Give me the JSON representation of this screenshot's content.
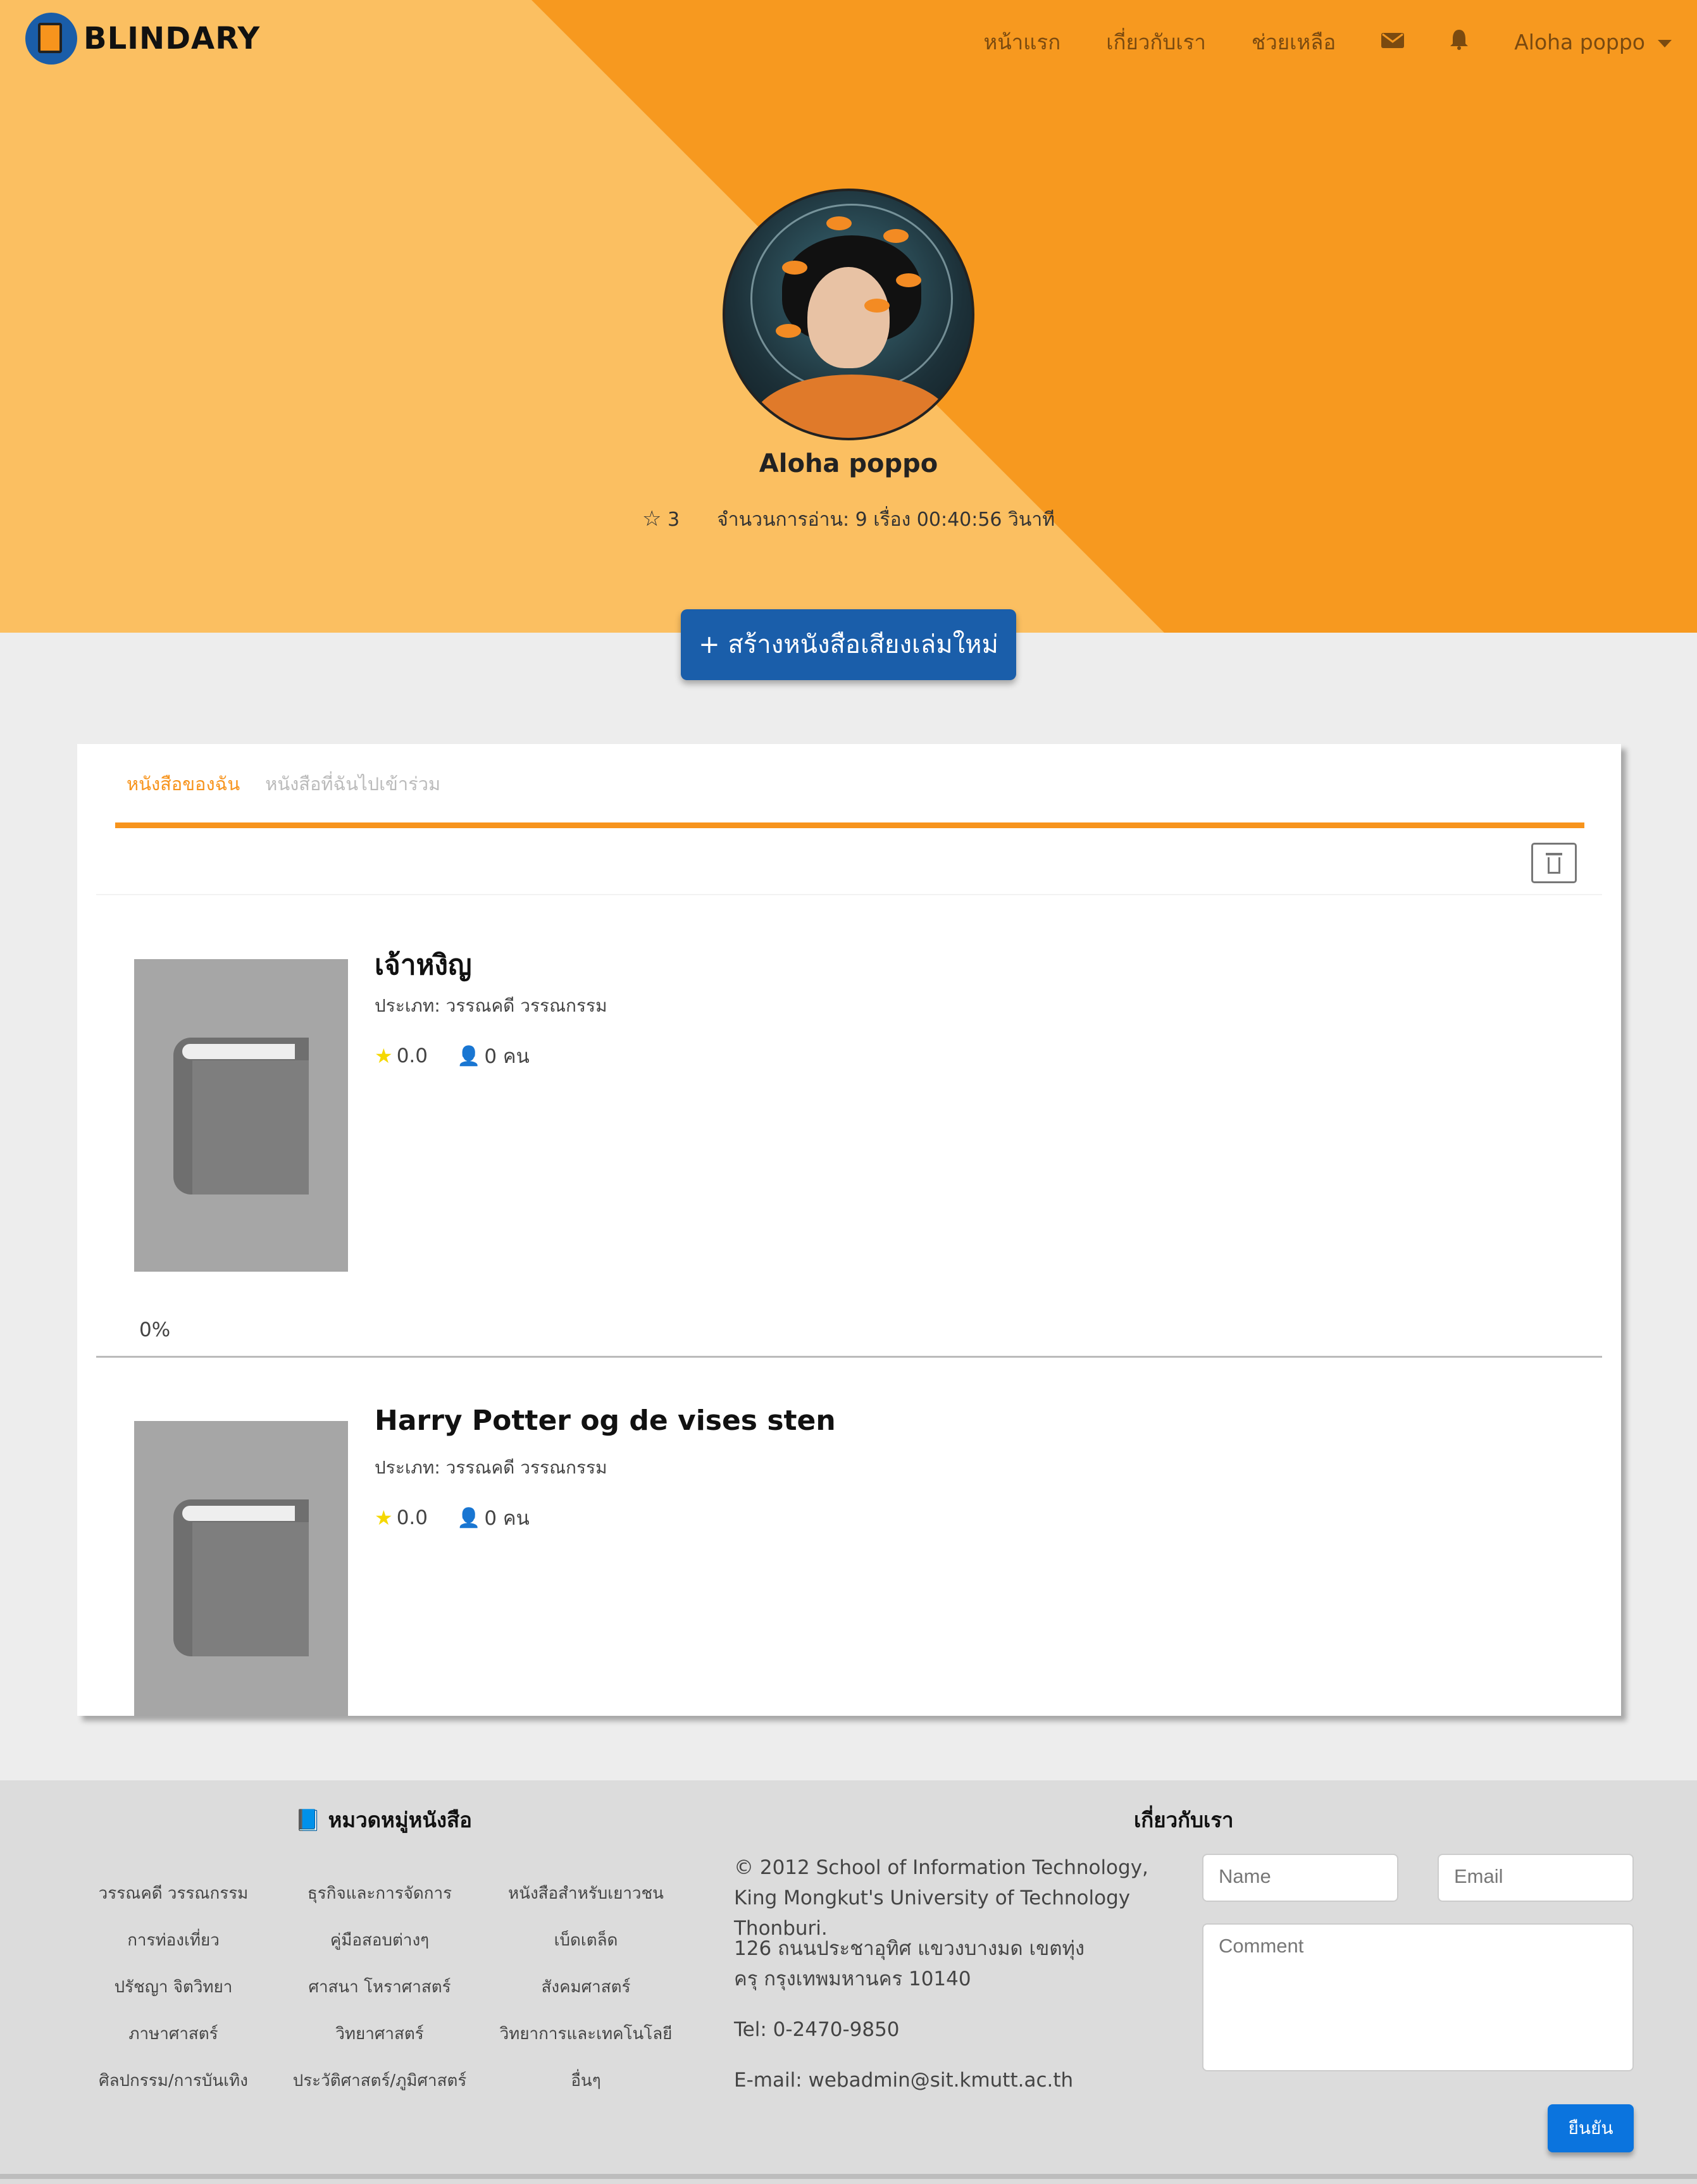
{
  "brand": {
    "name": "BLINDARY",
    "color_primary": "#f7941d",
    "color_secondary": "#1a5eaa"
  },
  "nav": {
    "links": [
      "หน้าแรก",
      "เกี่ยวกับเรา",
      "ช่วยเหลือ"
    ],
    "mail_icon": "envelope-icon",
    "bell_icon": "bell-icon",
    "user_name": "Aloha poppo"
  },
  "profile": {
    "name": "Aloha poppo",
    "stars": "3",
    "reading_stats": "จำนวนการอ่าน: 9 เรื่อง 00:40:56 วินาที"
  },
  "create_button": "+ สร้างหนังสือเสียงเล่มใหม่",
  "tabs": [
    "หนังสือของฉัน",
    "หนังสือที่ฉันไปเข้าร่วม"
  ],
  "books": [
    {
      "title": "เจ้าหงิญ",
      "category": "ประเภท: วรรณคดี วรรณกรรม",
      "rating": "0.0",
      "readers": "0 คน",
      "progress": "0%"
    },
    {
      "title": "Harry Potter og de vises sten",
      "category": "ประเภท: วรรณคดี วรรณกรรม",
      "rating": "0.0",
      "readers": "0 คน"
    }
  ],
  "footer": {
    "categories_heading": "หมวดหมู่หนังสือ",
    "categories": [
      "วรรณคดี วรรณกรรม",
      "ธุรกิจและการจัดการ",
      "หนังสือสำหรับเยาวชน",
      "การท่องเที่ยว",
      "คู่มือสอบต่างๆ",
      "เบ็ดเตล็ด",
      "ปรัชญา จิตวิทยา",
      "ศาสนา โหราศาสตร์",
      "สังคมศาสตร์",
      "ภาษาศาสตร์",
      "วิทยาศาสตร์",
      "วิทยาการและเทคโนโลยี",
      "ศิลปกรรม/การบันเทิง",
      "ประวัติศาสตร์/ภูมิศาสตร์",
      "อื่นๆ"
    ],
    "about_heading": "เกี่ยวกับเรา",
    "copyright": "© 2012 School of Information Technology, King Mongkut's University of Technology Thonburi.",
    "address": "126 ถนนประชาอุทิศ แขวงบางมด เขตทุ่งครุ กรุงเทพมหานคร 10140",
    "tel": "Tel: 0-2470-9850",
    "email": "E-mail: webadmin@sit.kmutt.ac.th",
    "name_placeholder": "Name",
    "email_placeholder": "Email",
    "comment_placeholder": "Comment",
    "submit": "ยืนยัน"
  }
}
